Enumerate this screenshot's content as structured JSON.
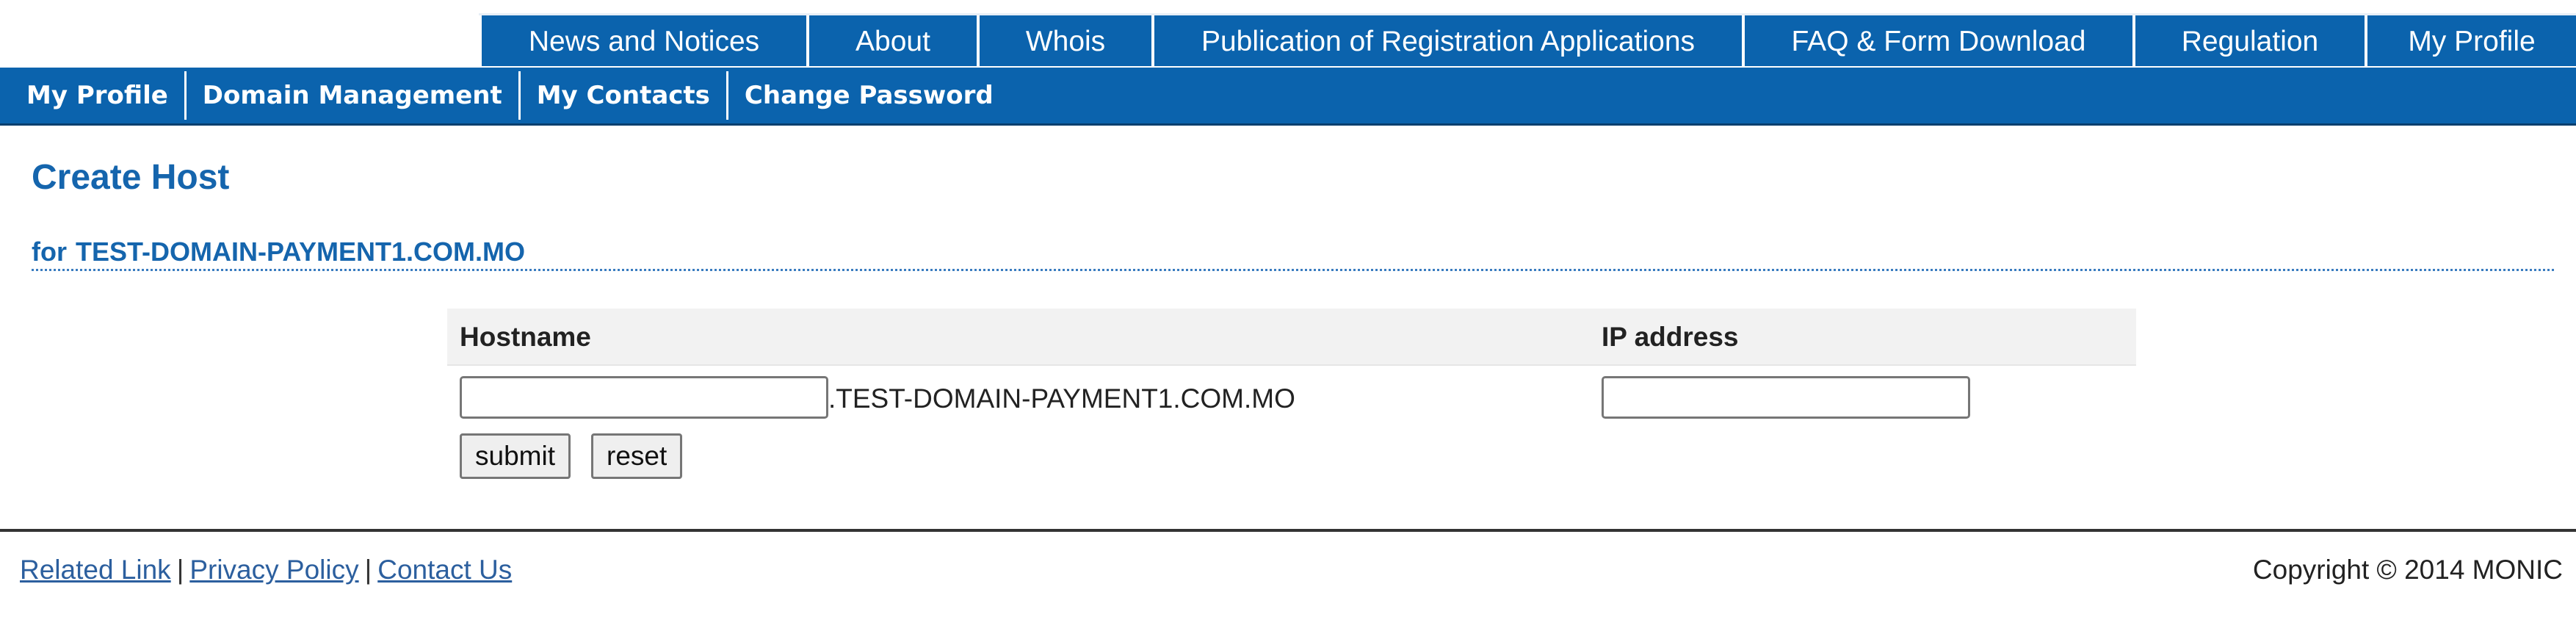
{
  "top_nav": {
    "items": [
      {
        "label": "News and Notices"
      },
      {
        "label": "About"
      },
      {
        "label": "Whois"
      },
      {
        "label": "Publication of Registration Applications"
      },
      {
        "label": "FAQ & Form Download"
      },
      {
        "label": "Regulation"
      },
      {
        "label": "My Profile"
      }
    ]
  },
  "sub_nav": {
    "items": [
      {
        "label": "My Profile"
      },
      {
        "label": "Domain Management"
      },
      {
        "label": "My Contacts"
      },
      {
        "label": "Change Password"
      }
    ]
  },
  "page": {
    "title": "Create Host",
    "subtitle_prefix": "for",
    "domain": "TEST-DOMAIN-PAYMENT1.COM.MO"
  },
  "form": {
    "hostname_header": "Hostname",
    "ip_header": "IP address",
    "hostname_value": "",
    "host_suffix": ".TEST-DOMAIN-PAYMENT1.COM.MO",
    "ip_value": "",
    "submit_label": "submit",
    "reset_label": "reset"
  },
  "footer": {
    "links": {
      "related": "Related Link",
      "privacy": "Privacy Policy",
      "contact": "Contact Us"
    },
    "separator": "|",
    "copyright": "Copyright © 2014 MONIC"
  },
  "colors": {
    "nav_blue": "#0b63ad",
    "heading_blue": "#1565ad",
    "link_blue": "#2c5f9e"
  }
}
